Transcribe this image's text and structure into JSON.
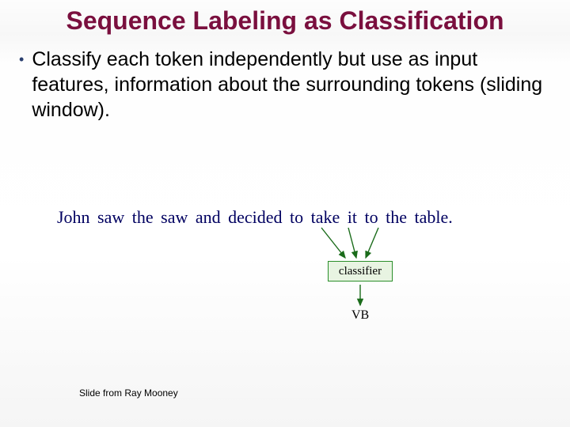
{
  "title": "Sequence Labeling as Classification",
  "bullet": "Classify each token independently but use as input features, information about the surrounding tokens (sliding window).",
  "sentence": "John  saw  the  saw  and  decided  to  take  it    to   the   table.",
  "classifier_label": "classifier",
  "output": "VB",
  "footer": "Slide from Ray Mooney"
}
